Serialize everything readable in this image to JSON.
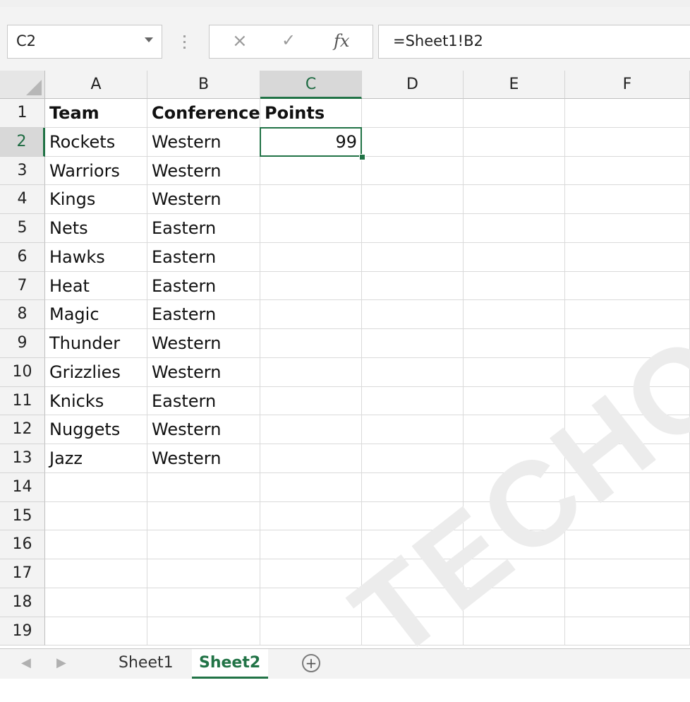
{
  "formula_bar": {
    "name_box": "C2",
    "cancel_symbol": "×",
    "enter_symbol": "✓",
    "fx_label": "fx",
    "formula": "=Sheet1!B2"
  },
  "columns": [
    "A",
    "B",
    "C",
    "D",
    "E",
    "F"
  ],
  "rows": [
    "1",
    "2",
    "3",
    "4",
    "5",
    "6",
    "7",
    "8",
    "9",
    "10",
    "11",
    "12",
    "13",
    "14",
    "15",
    "16",
    "17",
    "18",
    "19"
  ],
  "headers": {
    "a": "Team",
    "b": "Conference",
    "c": "Points"
  },
  "data": [
    {
      "team": "Rockets",
      "conference": "Western",
      "points": "99"
    },
    {
      "team": "Warriors",
      "conference": "Western",
      "points": ""
    },
    {
      "team": "Kings",
      "conference": "Western",
      "points": ""
    },
    {
      "team": "Nets",
      "conference": "Eastern",
      "points": ""
    },
    {
      "team": "Hawks",
      "conference": "Eastern",
      "points": ""
    },
    {
      "team": "Heat",
      "conference": "Eastern",
      "points": ""
    },
    {
      "team": "Magic",
      "conference": "Eastern",
      "points": ""
    },
    {
      "team": "Thunder",
      "conference": "Western",
      "points": ""
    },
    {
      "team": "Grizzlies",
      "conference": "Western",
      "points": ""
    },
    {
      "team": "Knicks",
      "conference": "Eastern",
      "points": ""
    },
    {
      "team": "Nuggets",
      "conference": "Western",
      "points": ""
    },
    {
      "team": "Jazz",
      "conference": "Western",
      "points": ""
    }
  ],
  "selection": {
    "column": "C",
    "row": "2"
  },
  "tabs": [
    {
      "label": "Sheet1",
      "active": false
    },
    {
      "label": "Sheet2",
      "active": true
    }
  ],
  "add_sheet_symbol": "+",
  "watermark": "TECHOLOGY",
  "colors": {
    "accent": "#217346",
    "grid": "#dadada",
    "header_bg": "#f3f3f3"
  }
}
